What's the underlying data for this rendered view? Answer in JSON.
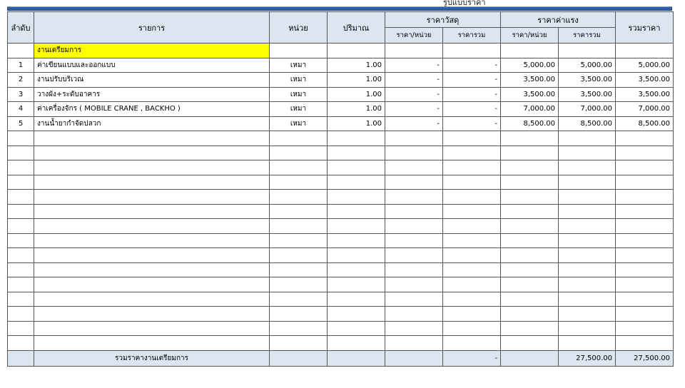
{
  "page_title": "รูปแบบราคา",
  "table": {
    "headers": {
      "seq": "ลำดับ",
      "item": "รายการ",
      "unit": "หน่วย",
      "qty": "ปริมาณ",
      "material": "ราคาวัสดุ",
      "labor": "ราคาค่าแรง",
      "total": "รวมราคา",
      "unit_price": "ราคา/หน่วย",
      "sum_price": "ราคารวม"
    },
    "section_title": "งานเตรียมการ",
    "rows": [
      {
        "no": "1",
        "item": "ค่าเขียนแบบและออกแบบ",
        "unit": "เหมา",
        "qty": "1.00",
        "mat_unit": "-",
        "mat_total": "-",
        "lab_unit": "5,000.00",
        "lab_total": "5,000.00",
        "total": "5,000.00"
      },
      {
        "no": "2",
        "item": "งานปรับบริเวณ",
        "unit": "เหมา",
        "qty": "1.00",
        "mat_unit": "-",
        "mat_total": "-",
        "lab_unit": "3,500.00",
        "lab_total": "3,500.00",
        "total": "3,500.00"
      },
      {
        "no": "3",
        "item": "วางผัง+ระดับอาคาร",
        "unit": "เหมา",
        "qty": "1.00",
        "mat_unit": "-",
        "mat_total": "-",
        "lab_unit": "3,500.00",
        "lab_total": "3,500.00",
        "total": "3,500.00"
      },
      {
        "no": "4",
        "item": "ค่าเครื่องจักร ( MOBILE CRANE , BACKHO )",
        "unit": "เหมา",
        "qty": "1.00",
        "mat_unit": "-",
        "mat_total": "-",
        "lab_unit": "7,000.00",
        "lab_total": "7,000.00",
        "total": "7,000.00"
      },
      {
        "no": "5",
        "item": "งานน้ำยากำจัดปลวก",
        "unit": "เหมา",
        "qty": "1.00",
        "mat_unit": "-",
        "mat_total": "-",
        "lab_unit": "8,500.00",
        "lab_total": "8,500.00",
        "total": "8,500.00"
      }
    ],
    "footer": {
      "label": "รวมราคางานเตรียมการ",
      "mat_total": "-",
      "lab_total": "27,500.00",
      "total": "27,500.00"
    }
  }
}
